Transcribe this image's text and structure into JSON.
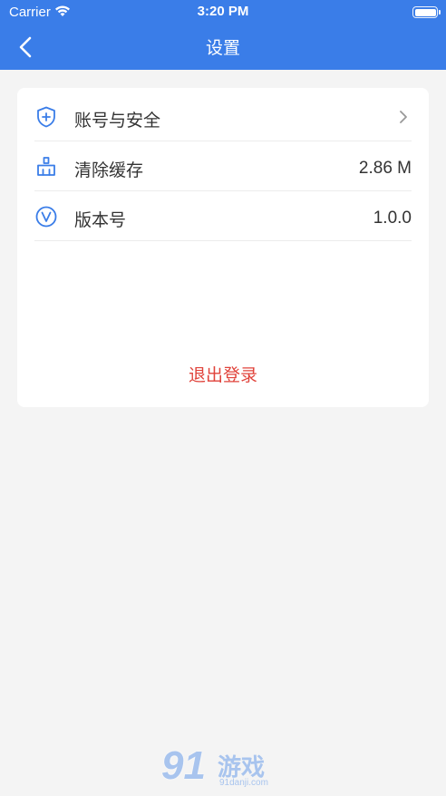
{
  "status_bar": {
    "carrier": "Carrier",
    "time": "3:20 PM",
    "battery_level": 1.0
  },
  "nav": {
    "title": "设置"
  },
  "settings": {
    "items": [
      {
        "label": "账号与安全",
        "value": "",
        "icon": "shield-plus-icon",
        "has_chevron": true
      },
      {
        "label": "清除缓存",
        "value": "2.86 M",
        "icon": "broom-icon",
        "has_chevron": false
      },
      {
        "label": "版本号",
        "value": "1.0.0",
        "icon": "version-v-icon",
        "has_chevron": false
      }
    ],
    "logout_label": "退出登录"
  },
  "watermark": {
    "logo": "91",
    "text": "游戏",
    "sub": "91danji.com"
  },
  "colors": {
    "header": "#3a7de8",
    "background": "#f4f4f4",
    "icon_blue": "#3a7de8",
    "logout_red": "#e0433b"
  }
}
